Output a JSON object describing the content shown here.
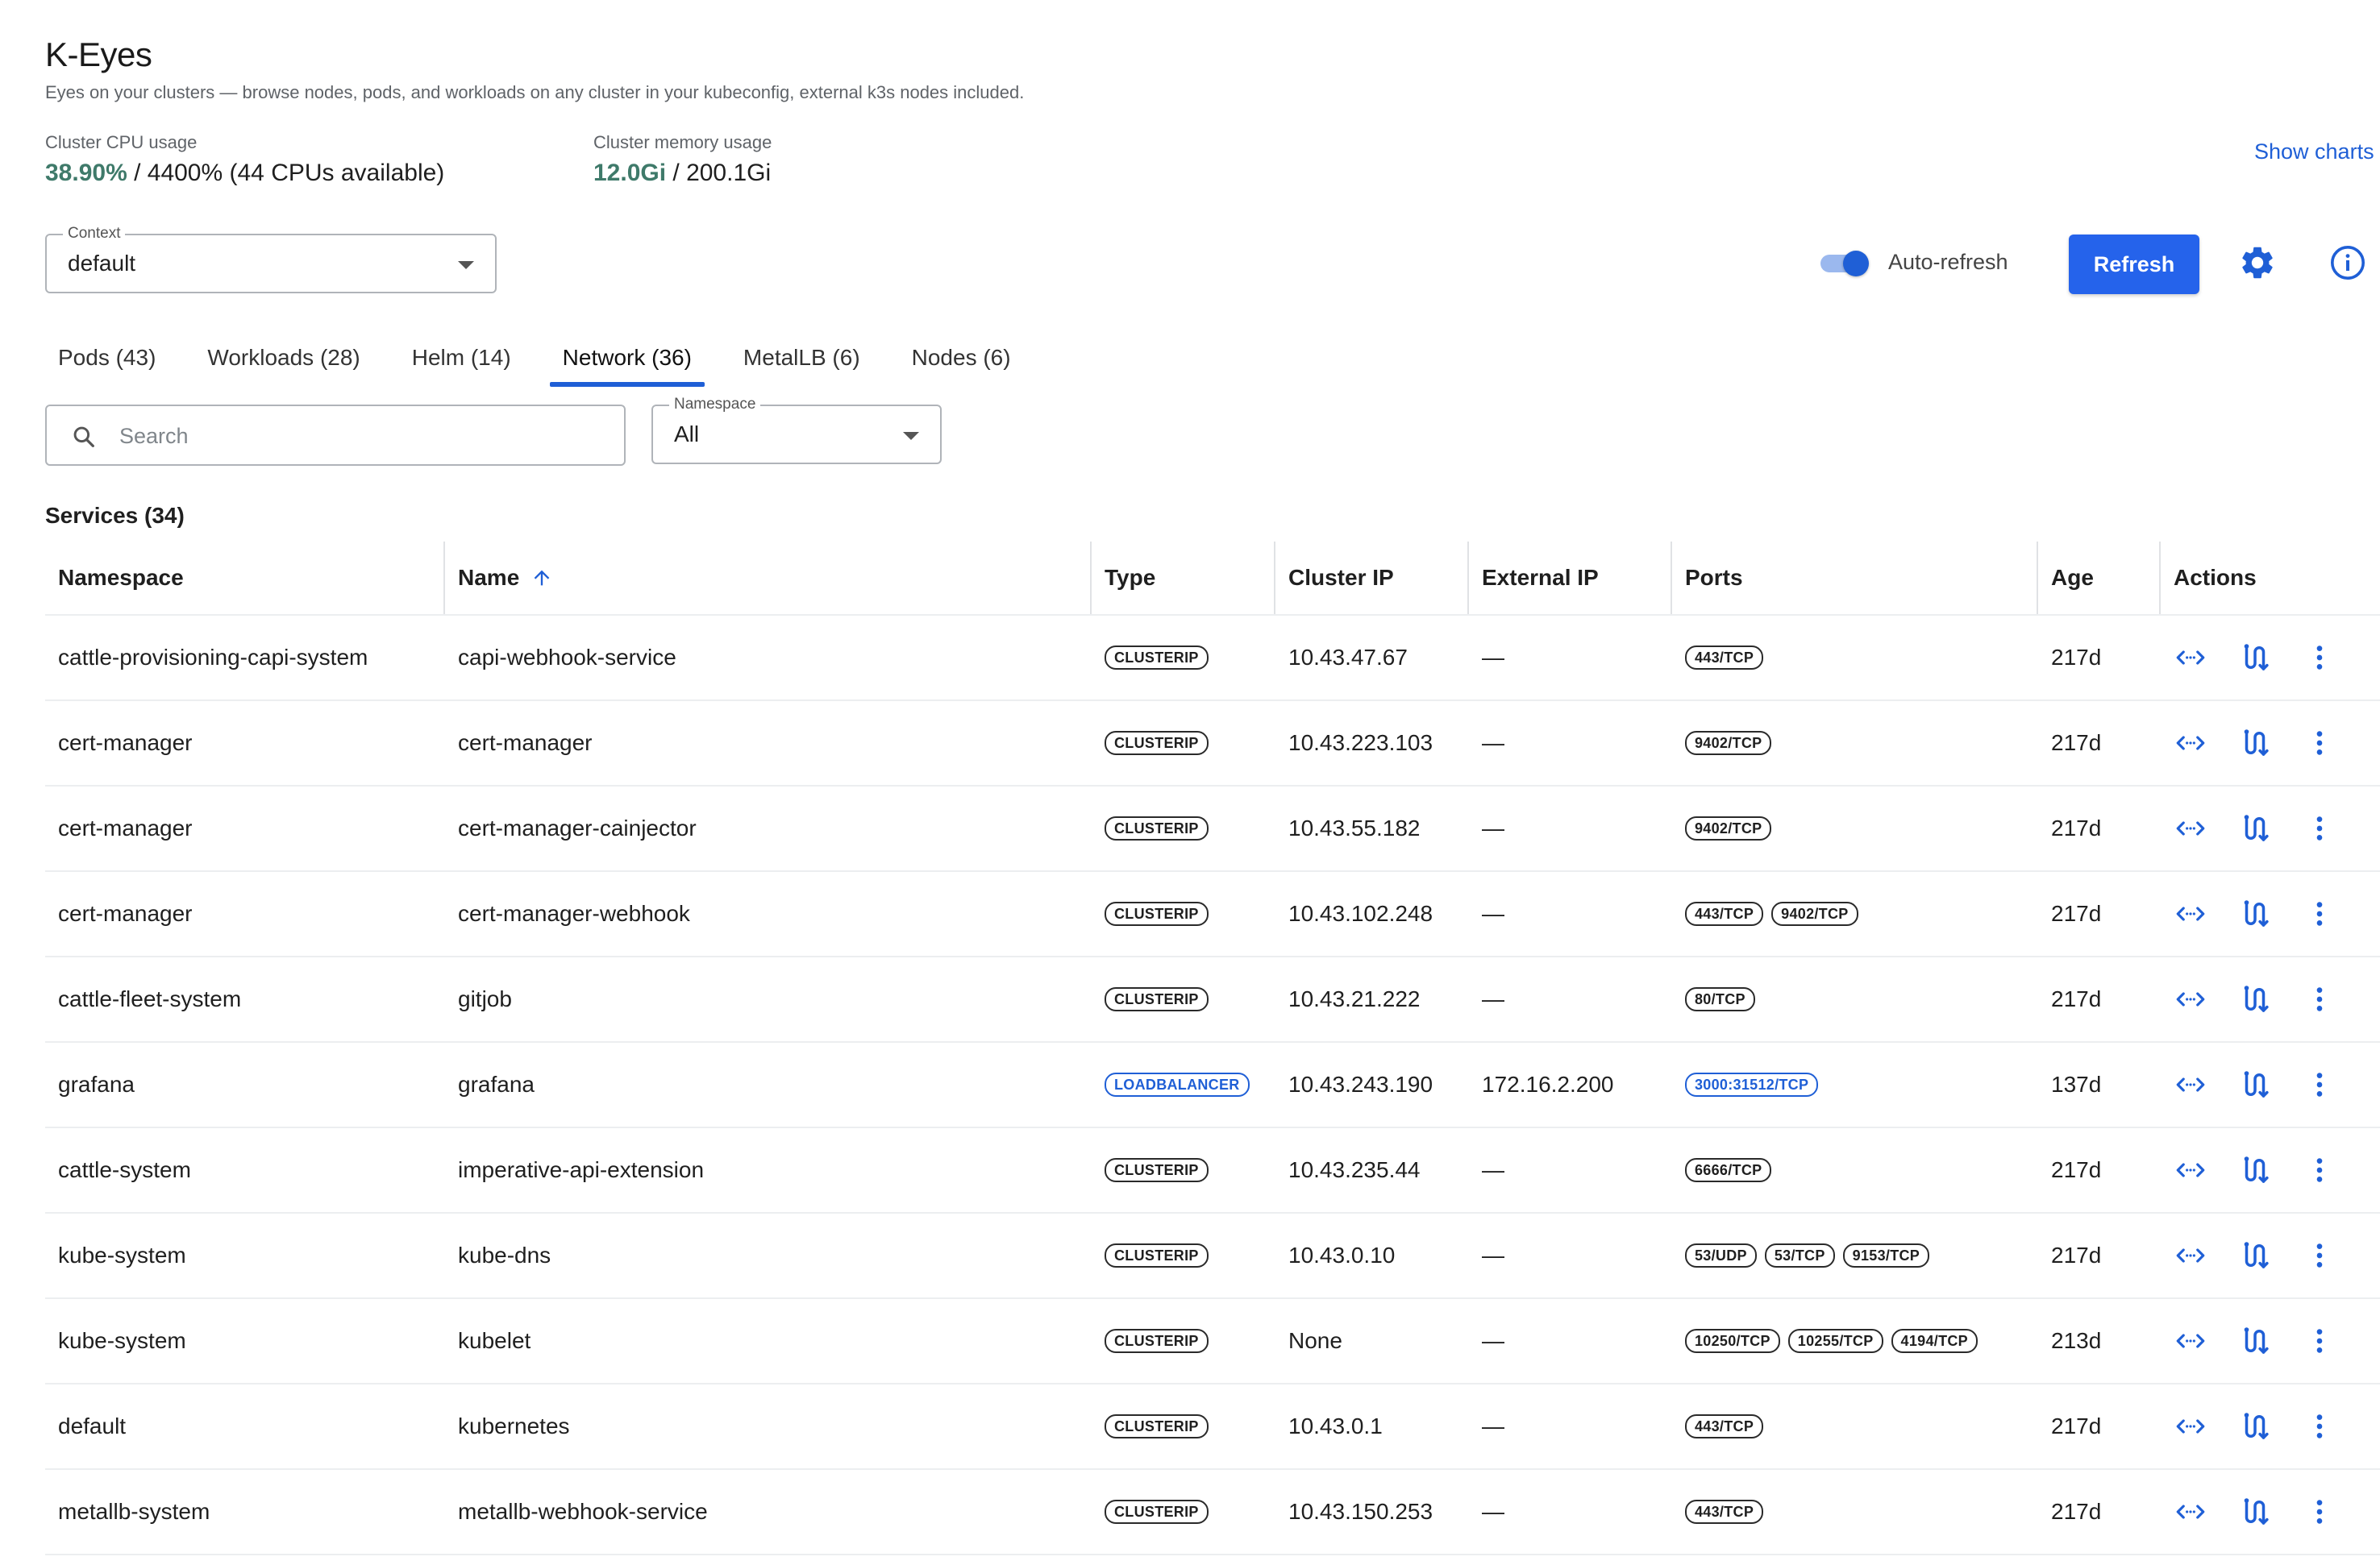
{
  "app": {
    "title": "K-Eyes",
    "subtitle": "Eyes on your clusters — browse nodes, pods, and workloads on any cluster in your kubeconfig, external k3s nodes included."
  },
  "metrics": {
    "cpu": {
      "label": "Cluster CPU usage",
      "value": "38.90%",
      "rest": " / 4400% (44 CPUs available)",
      "color": "#3f7a6a"
    },
    "memory": {
      "label": "Cluster memory usage",
      "value": "12.0Gi",
      "rest": " / 200.1Gi",
      "color": "#3f7a6a"
    }
  },
  "show_charts": "Show charts",
  "context": {
    "label": "Context",
    "value": "default"
  },
  "toolbar": {
    "auto_refresh_label": "Auto-refresh",
    "auto_refresh_on": true,
    "refresh_label": "Refresh"
  },
  "tabs": [
    {
      "label": "Pods (43)",
      "active": false
    },
    {
      "label": "Workloads (28)",
      "active": false
    },
    {
      "label": "Helm (14)",
      "active": false
    },
    {
      "label": "Network (36)",
      "active": true
    },
    {
      "label": "MetalLB (6)",
      "active": false
    },
    {
      "label": "Nodes (6)",
      "active": false
    }
  ],
  "search": {
    "placeholder": "Search",
    "value": ""
  },
  "namespace_filter": {
    "label": "Namespace",
    "value": "All"
  },
  "services": {
    "title": "Services (34)",
    "columns": [
      "Namespace",
      "Name",
      "Type",
      "Cluster IP",
      "External IP",
      "Ports",
      "Age",
      "Actions"
    ],
    "rows": [
      {
        "namespace": "cattle-provisioning-capi-system",
        "name": "capi-webhook-service",
        "type": "CLUSTERIP",
        "cluster_ip": "10.43.47.67",
        "external_ip": "—",
        "ports": [
          "443/TCP"
        ],
        "age": "217d"
      },
      {
        "namespace": "cert-manager",
        "name": "cert-manager",
        "type": "CLUSTERIP",
        "cluster_ip": "10.43.223.103",
        "external_ip": "—",
        "ports": [
          "9402/TCP"
        ],
        "age": "217d"
      },
      {
        "namespace": "cert-manager",
        "name": "cert-manager-cainjector",
        "type": "CLUSTERIP",
        "cluster_ip": "10.43.55.182",
        "external_ip": "—",
        "ports": [
          "9402/TCP"
        ],
        "age": "217d"
      },
      {
        "namespace": "cert-manager",
        "name": "cert-manager-webhook",
        "type": "CLUSTERIP",
        "cluster_ip": "10.43.102.248",
        "external_ip": "—",
        "ports": [
          "443/TCP",
          "9402/TCP"
        ],
        "age": "217d"
      },
      {
        "namespace": "cattle-fleet-system",
        "name": "gitjob",
        "type": "CLUSTERIP",
        "cluster_ip": "10.43.21.222",
        "external_ip": "—",
        "ports": [
          "80/TCP"
        ],
        "age": "217d"
      },
      {
        "namespace": "grafana",
        "name": "grafana",
        "type": "LOADBALANCER",
        "cluster_ip": "10.43.243.190",
        "external_ip": "172.16.2.200",
        "ports": [
          "3000:31512/TCP"
        ],
        "age": "137d"
      },
      {
        "namespace": "cattle-system",
        "name": "imperative-api-extension",
        "type": "CLUSTERIP",
        "cluster_ip": "10.43.235.44",
        "external_ip": "—",
        "ports": [
          "6666/TCP"
        ],
        "age": "217d"
      },
      {
        "namespace": "kube-system",
        "name": "kube-dns",
        "type": "CLUSTERIP",
        "cluster_ip": "10.43.0.10",
        "external_ip": "—",
        "ports": [
          "53/UDP",
          "53/TCP",
          "9153/TCP"
        ],
        "age": "217d"
      },
      {
        "namespace": "kube-system",
        "name": "kubelet",
        "type": "CLUSTERIP",
        "cluster_ip": "None",
        "external_ip": "—",
        "ports": [
          "10250/TCP",
          "10255/TCP",
          "4194/TCP"
        ],
        "age": "213d"
      },
      {
        "namespace": "default",
        "name": "kubernetes",
        "type": "CLUSTERIP",
        "cluster_ip": "10.43.0.1",
        "external_ip": "—",
        "ports": [
          "443/TCP"
        ],
        "age": "217d"
      },
      {
        "namespace": "metallb-system",
        "name": "metallb-webhook-service",
        "type": "CLUSTERIP",
        "cluster_ip": "10.43.150.253",
        "external_ip": "—",
        "ports": [
          "443/TCP"
        ],
        "age": "217d"
      }
    ]
  },
  "row_actions": [
    "port-forward-icon",
    "routes-icon",
    "more-vert-icon"
  ],
  "colors": {
    "accent": "#1f5fd6",
    "button": "#2563eb",
    "metric": "#3f7a6a"
  }
}
